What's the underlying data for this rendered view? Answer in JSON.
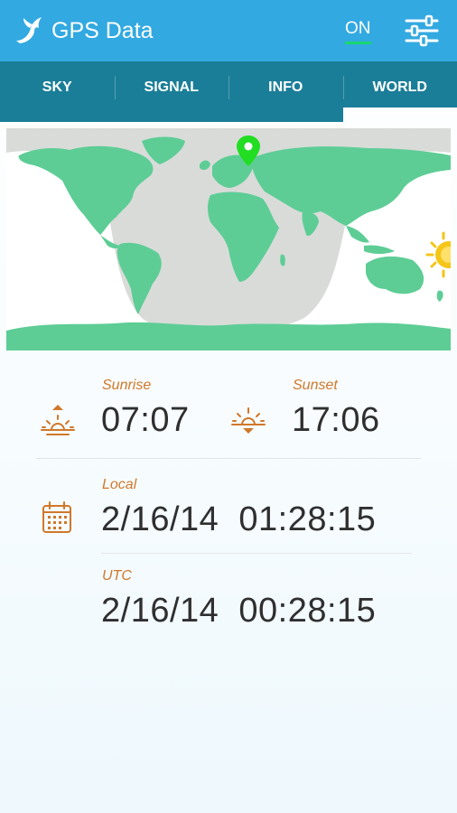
{
  "app": {
    "title": "GPS Data",
    "toggle_label": "ON"
  },
  "tabs": [
    {
      "label": "SKY"
    },
    {
      "label": "SIGNAL"
    },
    {
      "label": "INFO"
    },
    {
      "label": "WORLD",
      "active": true
    }
  ],
  "sun": {
    "sunrise_label": "Sunrise",
    "sunrise_time": "07:07",
    "sunset_label": "Sunset",
    "sunset_time": "17:06"
  },
  "local": {
    "label": "Local",
    "value": "2/16/14  01:28:15"
  },
  "utc": {
    "label": "UTC",
    "value": "2/16/14  00:28:15"
  },
  "icons": [
    "gps-bird-logo-icon",
    "settings-sliders-icon",
    "location-pin-icon",
    "sun-icon",
    "sunrise-icon",
    "sunset-icon",
    "calendar-icon"
  ],
  "colors": {
    "appbar": "#32a9e1",
    "tabbar": "#1b7e98",
    "toggle_underline": "#18d86e",
    "land": "#5dcd95",
    "night_overlay": "#d9dbd9",
    "pin": "#22dd22",
    "sun": "#f5c518",
    "accent_text": "#d0782a"
  }
}
